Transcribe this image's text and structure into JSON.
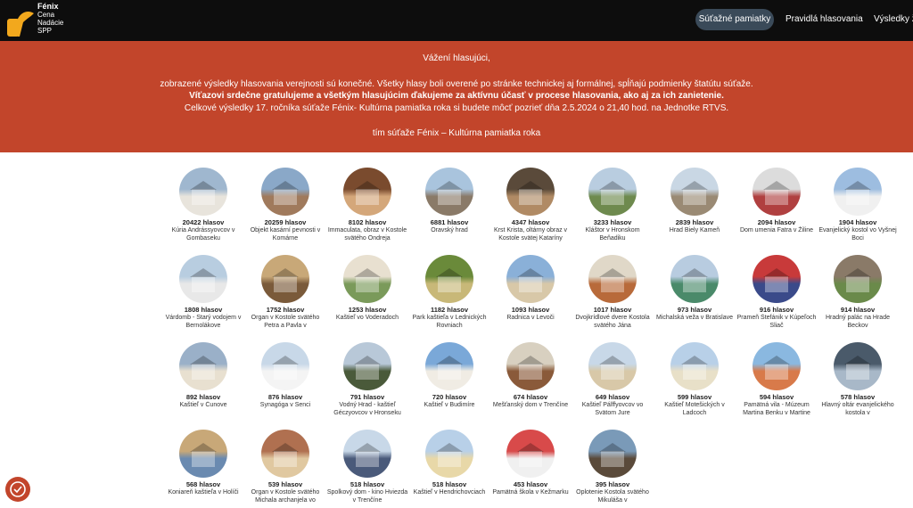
{
  "logo": {
    "line1": "Fénix",
    "line2": "Cena",
    "line3": "Nadácie",
    "line4": "SPP"
  },
  "nav": [
    {
      "label": "Súťažné pamiatky"
    },
    {
      "label": "Pravidlá hlasovania"
    },
    {
      "label": "Výsledky ž"
    }
  ],
  "banner": {
    "greeting": "Vážení hlasujúci,",
    "line1": "zobrazené výsledky hlasovania verejnosti sú konečné. Všetky hlasy boli overené po stránke technickej aj formálnej, spĺňajú podmienky štatútu súťaže.",
    "line2": "Víťazovi srdečne gratulujeme a všetkým hlasujúcim ďakujeme za aktívnu účasť v procese hlasovania, ako aj za ich zanietenie.",
    "line3": "Celkové výsledky 17. ročníka súťaže Fénix- Kultúrna pamiatka roka si budete môcť pozrieť dňa 2.5.2024 o 21,40 hod. na Jednotke RTVS.",
    "signature": "tím súťaže Fénix – Kultúrna pamiatka roka"
  },
  "monuments": [
    {
      "votes": "20422 hlasov",
      "name": "Kúria Andrássyovcov v Gombaseku",
      "c1": "#9fb7cf",
      "c2": "#e8e4dc"
    },
    {
      "votes": "20259 hlasov",
      "name": "Objekt kasární pevnosti v Komárne",
      "c1": "#8aa8c8",
      "c2": "#a07a5c"
    },
    {
      "votes": "8102 hlasov",
      "name": "Immaculata, obraz v Kostole svätého Ondreja",
      "c1": "#7a4b2e",
      "c2": "#d4a77a"
    },
    {
      "votes": "6881 hlasov",
      "name": "Oravský hrad",
      "c1": "#a9c4dd",
      "c2": "#8a7a68"
    },
    {
      "votes": "4347 hlasov",
      "name": "Krst Krista, oltárny obraz v Kostole svätej Kataríny",
      "c1": "#5a4a3a",
      "c2": "#b08a64"
    },
    {
      "votes": "3233 hlasov",
      "name": "Kláštor v Hronskom Beňadiku",
      "c1": "#b9cde0",
      "c2": "#6e8a4e"
    },
    {
      "votes": "2839 hlasov",
      "name": "Hrad Biely Kameň",
      "c1": "#c9d7e4",
      "c2": "#9a8a74"
    },
    {
      "votes": "2094 hlasov",
      "name": "Dom umenia Fatra v Žiline",
      "c1": "#dcdcdc",
      "c2": "#b04040"
    },
    {
      "votes": "1904 hlasov",
      "name": "Evanjelický kostol vo Vyšnej Boci",
      "c1": "#9dbde0",
      "c2": "#f0f0f0"
    },
    {
      "votes": "1808 hlasov",
      "name": "Várdomb - Starý vodojem v Bernolákove",
      "c1": "#b8cde0",
      "c2": "#e8e8e8"
    },
    {
      "votes": "1752 hlasov",
      "name": "Organ v Kostole svätého Petra a Pavla v",
      "c1": "#c8a878",
      "c2": "#7a5a3a"
    },
    {
      "votes": "1253 hlasov",
      "name": "Kaštieľ vo Voderadoch",
      "c1": "#e8e0d0",
      "c2": "#7a9a5a"
    },
    {
      "votes": "1182 hlasov",
      "name": "Park kaštieľa v Lednických Rovniach",
      "c1": "#6a8a3a",
      "c2": "#c8b878"
    },
    {
      "votes": "1093 hlasov",
      "name": "Radnica v Levoči",
      "c1": "#8ab0d8",
      "c2": "#d8c8a8"
    },
    {
      "votes": "1017 hlasov",
      "name": "Dvojkrídlové dvere Kostola svätého Jána",
      "c1": "#e0d8c8",
      "c2": "#b86a3a"
    },
    {
      "votes": "973 hlasov",
      "name": "Michalská veža v Bratislave",
      "c1": "#b8cce0",
      "c2": "#4a8a6a"
    },
    {
      "votes": "916 hlasov",
      "name": "Prameň Štefánik v Kúpeľoch Sliač",
      "c1": "#c83a3a",
      "c2": "#3a4a8a"
    },
    {
      "votes": "914 hlasov",
      "name": "Hradný palác na Hrade Beckov",
      "c1": "#8a7a68",
      "c2": "#6a8a4a"
    },
    {
      "votes": "892 hlasov",
      "name": "Kaštieľ v Čunove",
      "c1": "#9ab0c8",
      "c2": "#e8e0d0"
    },
    {
      "votes": "876 hlasov",
      "name": "Synagóga v Senci",
      "c1": "#c8d8e8",
      "c2": "#f4f4f4"
    },
    {
      "votes": "791 hlasov",
      "name": "Vodný Hrad - kaštieľ Géczyovcov v Hronseku",
      "c1": "#b8c8d8",
      "c2": "#4a5a3a"
    },
    {
      "votes": "720 hlasov",
      "name": "Kaštieľ v Budimíre",
      "c1": "#7aa8d8",
      "c2": "#f0ece4"
    },
    {
      "votes": "674 hlasov",
      "name": "Mešťanský dom v Trenčíne",
      "c1": "#d8d0c0",
      "c2": "#8a5a3a"
    },
    {
      "votes": "649 hlasov",
      "name": "Kaštieľ Pálffyovcov vo Svätom Jure",
      "c1": "#c8d8e8",
      "c2": "#d8c8a8"
    },
    {
      "votes": "599 hlasov",
      "name": "Kaštieľ Motešických v Ladcoch",
      "c1": "#b8d0e8",
      "c2": "#e8e0c8"
    },
    {
      "votes": "594 hlasov",
      "name": "Pamätná vila - Múzeum Martina Benku v Martine",
      "c1": "#8ab8e0",
      "c2": "#d87a4a"
    },
    {
      "votes": "578 hlasov",
      "name": "Hlavný oltár evanjelického kostola v",
      "c1": "#4a5a6a",
      "c2": "#a8b8c8"
    },
    {
      "votes": "568 hlasov",
      "name": "Koniareň kaštieľa v Holíči",
      "c1": "#c8a878",
      "c2": "#6a8ab0"
    },
    {
      "votes": "539 hlasov",
      "name": "Organ v Kostole svätého Michala archanjela vo",
      "c1": "#b07050",
      "c2": "#e0c8a0"
    },
    {
      "votes": "518 hlasov",
      "name": "Spolkový dom - kino Hviezda v Trenčíne",
      "c1": "#c8d8e8",
      "c2": "#4a5a7a"
    },
    {
      "votes": "518 hlasov",
      "name": "Kaštieľ v Hendrichovciach",
      "c1": "#b8d0e8",
      "c2": "#e8d8a8"
    },
    {
      "votes": "453 hlasov",
      "name": "Pamätná škola v Kežmarku",
      "c1": "#d84a4a",
      "c2": "#f0f0f0"
    },
    {
      "votes": "395 hlasov",
      "name": "Oplotenie Kostola svätého Mikuláša v",
      "c1": "#7a9ab8",
      "c2": "#5a4a3a"
    }
  ]
}
